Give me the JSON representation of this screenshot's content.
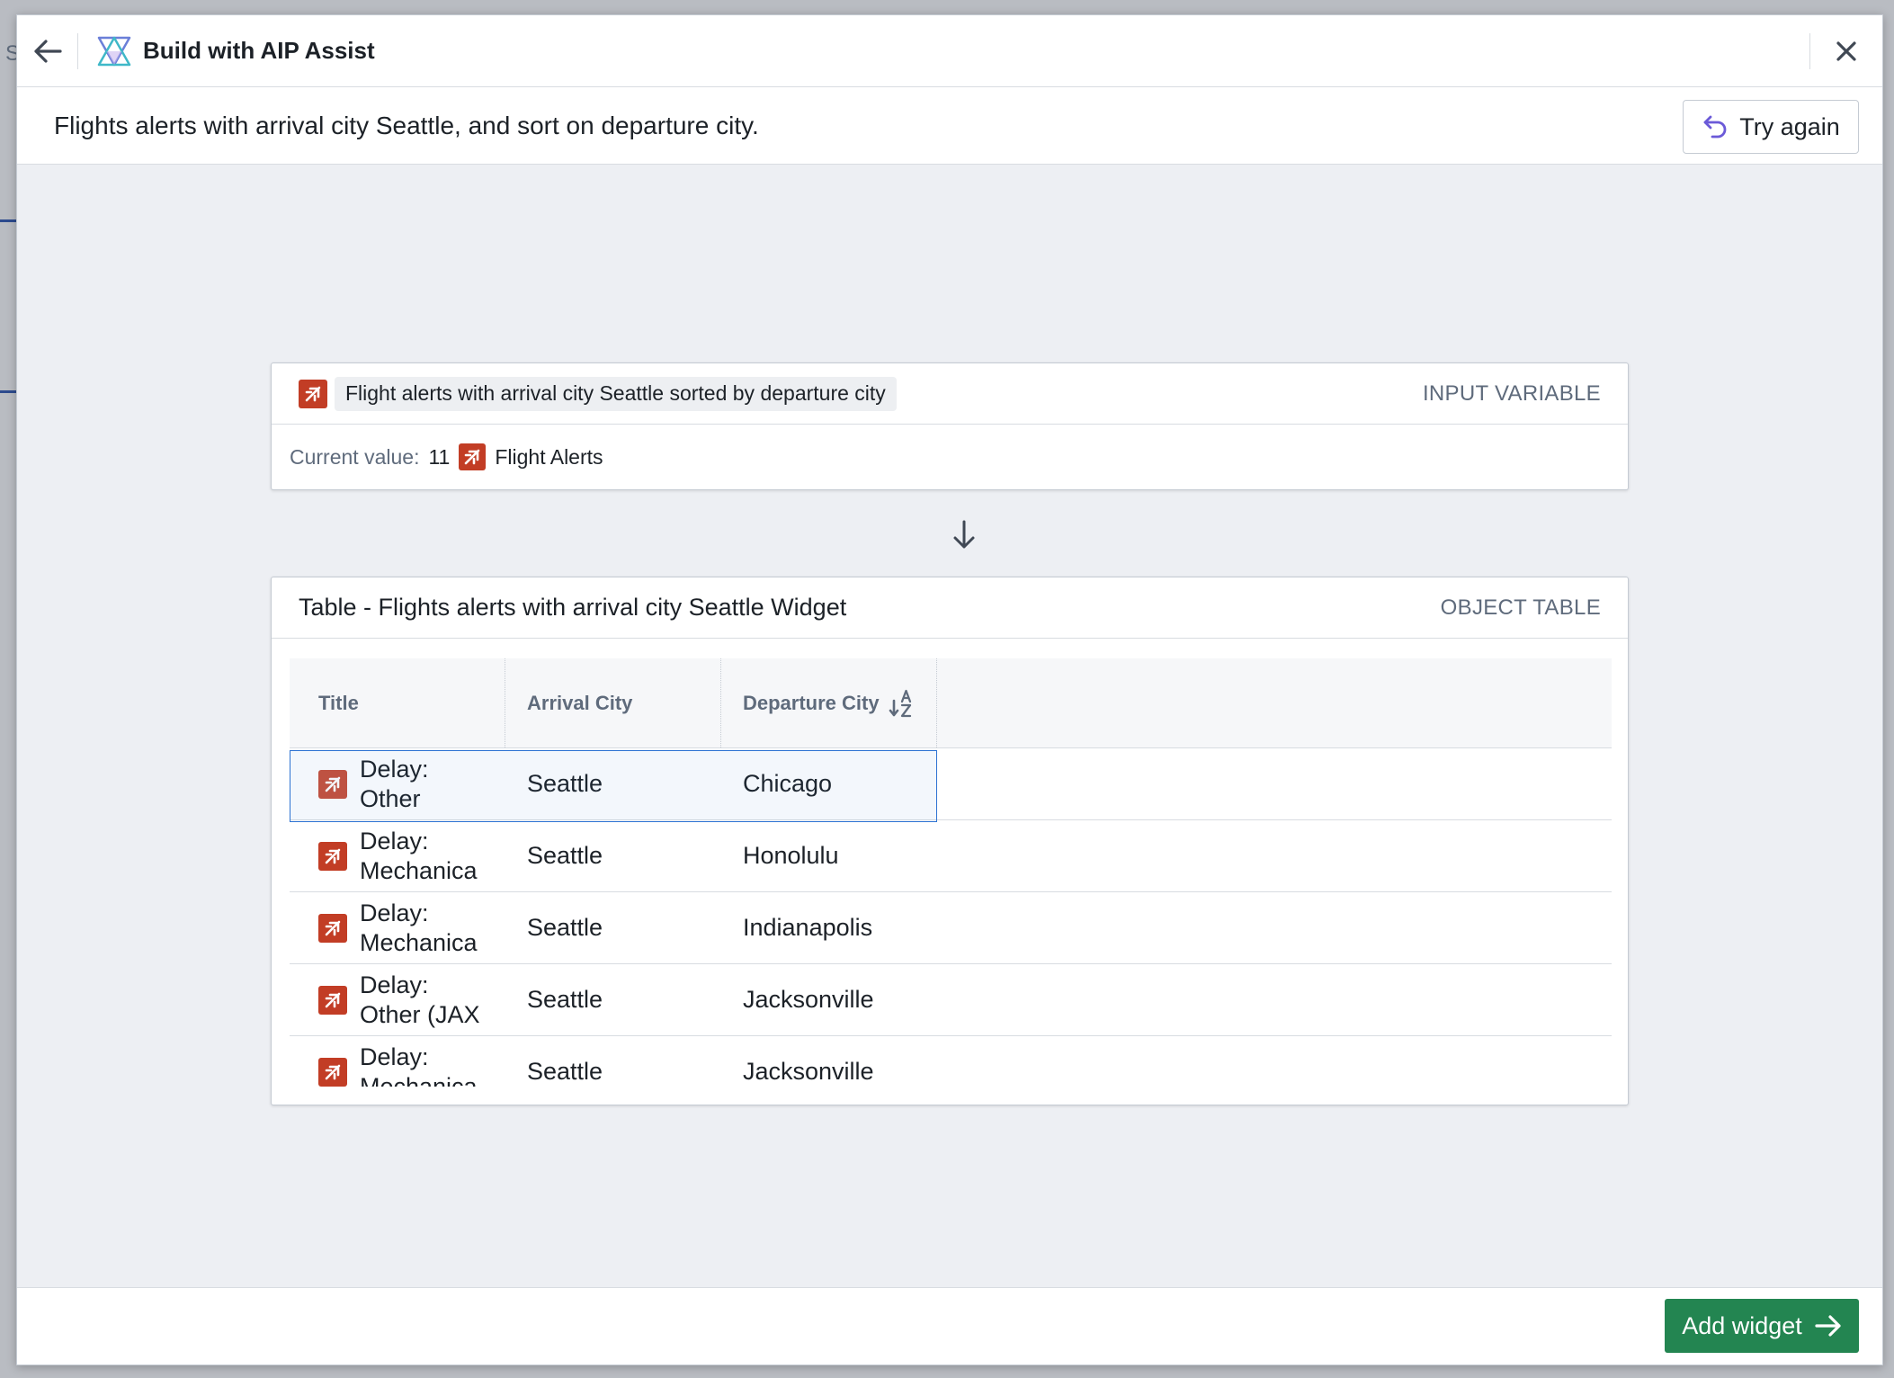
{
  "background": {
    "letter": "S"
  },
  "header": {
    "title": "Build with AIP Assist"
  },
  "prompt": {
    "text": "Flights alerts with arrival city Seattle, and sort on departure city.",
    "try_again_label": "Try again"
  },
  "input_card": {
    "chip_label": "Flight alerts with arrival city Seattle sorted by departure city",
    "tag": "INPUT VARIABLE",
    "current_label": "Current value:",
    "current_count": "11",
    "current_name": "Flight Alerts"
  },
  "table_card": {
    "title": "Table - Flights alerts with arrival city Seattle Widget",
    "tag": "OBJECT TABLE",
    "columns": [
      "Title",
      "Arrival City",
      "Departure City"
    ],
    "rows": [
      {
        "title": "Delay: Other",
        "arrival": "Seattle",
        "departure": "Chicago"
      },
      {
        "title": "Delay: Mechanica",
        "arrival": "Seattle",
        "departure": "Honolulu"
      },
      {
        "title": "Delay: Mechanica",
        "arrival": "Seattle",
        "departure": "Indianapolis"
      },
      {
        "title": "Delay: Other (JAX",
        "arrival": "Seattle",
        "departure": "Jacksonville"
      },
      {
        "title": "Delay: Mechanica",
        "arrival": "Seattle",
        "departure": "Jacksonville"
      }
    ]
  },
  "footer": {
    "add_widget_label": "Add widget"
  },
  "colors": {
    "accent_green": "#238551",
    "object_icon": "#c23d25",
    "selection": "#2d72d2"
  }
}
